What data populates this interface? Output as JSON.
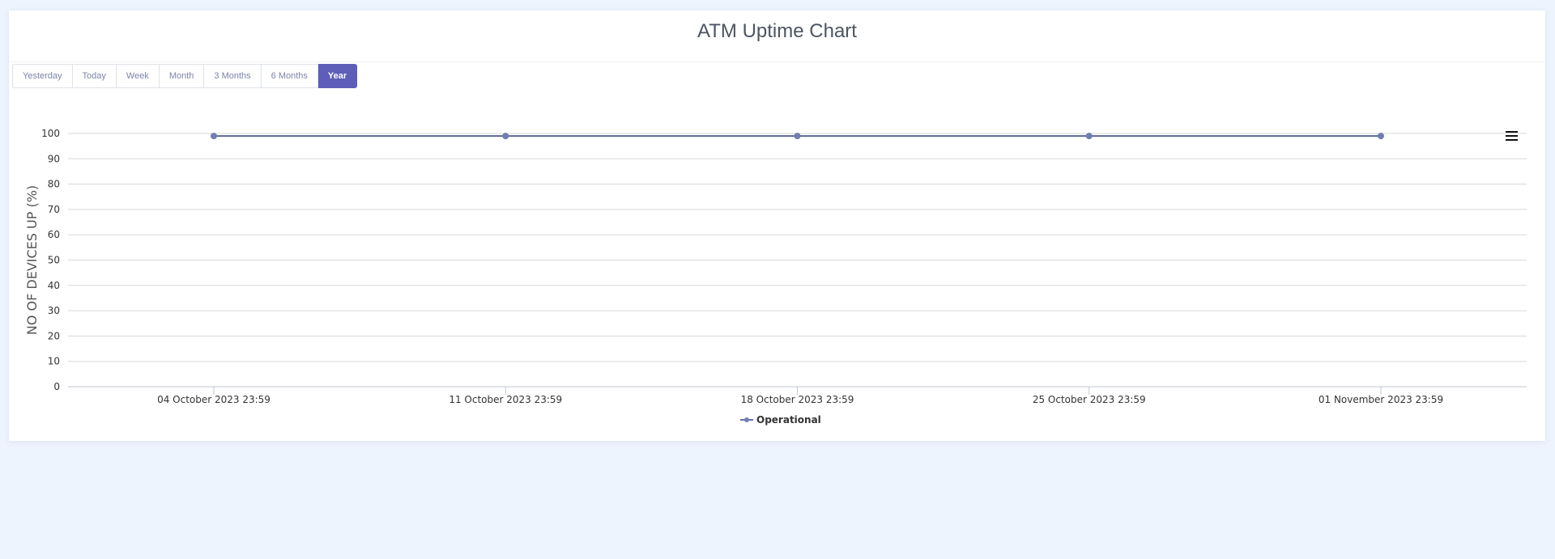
{
  "card": {
    "title": "ATM Uptime Chart"
  },
  "range_buttons": [
    {
      "label": "Yesterday"
    },
    {
      "label": "Today"
    },
    {
      "label": "Week"
    },
    {
      "label": "Month"
    },
    {
      "label": "3 Months"
    },
    {
      "label": "6 Months"
    },
    {
      "label": "Year",
      "active": true
    }
  ],
  "colors": {
    "accent": "#5e5eb8",
    "series_line": "#5a6494",
    "series_marker": "#6f7eb0",
    "gridline": "#d8d8d8",
    "page_background": "#eef4fd"
  },
  "chart_menu_icon": "hamburger-icon",
  "chart_data": {
    "type": "line",
    "ylabel": "NO OF DEVICES UP (%)",
    "xlabel": "",
    "ylim": [
      0,
      100
    ],
    "yticks": [
      0,
      10,
      20,
      30,
      40,
      50,
      60,
      70,
      80,
      90,
      100
    ],
    "categories": [
      "04 October 2023 23:59",
      "11 October 2023 23:59",
      "18 October 2023 23:59",
      "25 October 2023 23:59",
      "01 November 2023 23:59"
    ],
    "series": [
      {
        "name": "Operational",
        "values": [
          99,
          99,
          99,
          99,
          99
        ]
      }
    ],
    "grid": true,
    "legend": "bottom-center"
  }
}
